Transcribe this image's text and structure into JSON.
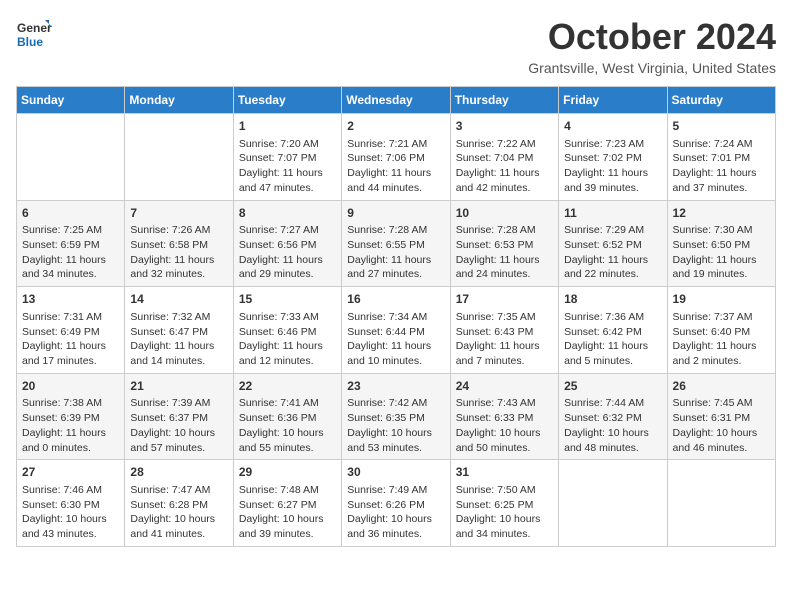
{
  "header": {
    "logo_line1": "General",
    "logo_line2": "Blue",
    "month": "October 2024",
    "location": "Grantsville, West Virginia, United States"
  },
  "days_of_week": [
    "Sunday",
    "Monday",
    "Tuesday",
    "Wednesday",
    "Thursday",
    "Friday",
    "Saturday"
  ],
  "weeks": [
    [
      {
        "day": "",
        "info": ""
      },
      {
        "day": "",
        "info": ""
      },
      {
        "day": "1",
        "info": "Sunrise: 7:20 AM\nSunset: 7:07 PM\nDaylight: 11 hours and 47 minutes."
      },
      {
        "day": "2",
        "info": "Sunrise: 7:21 AM\nSunset: 7:06 PM\nDaylight: 11 hours and 44 minutes."
      },
      {
        "day": "3",
        "info": "Sunrise: 7:22 AM\nSunset: 7:04 PM\nDaylight: 11 hours and 42 minutes."
      },
      {
        "day": "4",
        "info": "Sunrise: 7:23 AM\nSunset: 7:02 PM\nDaylight: 11 hours and 39 minutes."
      },
      {
        "day": "5",
        "info": "Sunrise: 7:24 AM\nSunset: 7:01 PM\nDaylight: 11 hours and 37 minutes."
      }
    ],
    [
      {
        "day": "6",
        "info": "Sunrise: 7:25 AM\nSunset: 6:59 PM\nDaylight: 11 hours and 34 minutes."
      },
      {
        "day": "7",
        "info": "Sunrise: 7:26 AM\nSunset: 6:58 PM\nDaylight: 11 hours and 32 minutes."
      },
      {
        "day": "8",
        "info": "Sunrise: 7:27 AM\nSunset: 6:56 PM\nDaylight: 11 hours and 29 minutes."
      },
      {
        "day": "9",
        "info": "Sunrise: 7:28 AM\nSunset: 6:55 PM\nDaylight: 11 hours and 27 minutes."
      },
      {
        "day": "10",
        "info": "Sunrise: 7:28 AM\nSunset: 6:53 PM\nDaylight: 11 hours and 24 minutes."
      },
      {
        "day": "11",
        "info": "Sunrise: 7:29 AM\nSunset: 6:52 PM\nDaylight: 11 hours and 22 minutes."
      },
      {
        "day": "12",
        "info": "Sunrise: 7:30 AM\nSunset: 6:50 PM\nDaylight: 11 hours and 19 minutes."
      }
    ],
    [
      {
        "day": "13",
        "info": "Sunrise: 7:31 AM\nSunset: 6:49 PM\nDaylight: 11 hours and 17 minutes."
      },
      {
        "day": "14",
        "info": "Sunrise: 7:32 AM\nSunset: 6:47 PM\nDaylight: 11 hours and 14 minutes."
      },
      {
        "day": "15",
        "info": "Sunrise: 7:33 AM\nSunset: 6:46 PM\nDaylight: 11 hours and 12 minutes."
      },
      {
        "day": "16",
        "info": "Sunrise: 7:34 AM\nSunset: 6:44 PM\nDaylight: 11 hours and 10 minutes."
      },
      {
        "day": "17",
        "info": "Sunrise: 7:35 AM\nSunset: 6:43 PM\nDaylight: 11 hours and 7 minutes."
      },
      {
        "day": "18",
        "info": "Sunrise: 7:36 AM\nSunset: 6:42 PM\nDaylight: 11 hours and 5 minutes."
      },
      {
        "day": "19",
        "info": "Sunrise: 7:37 AM\nSunset: 6:40 PM\nDaylight: 11 hours and 2 minutes."
      }
    ],
    [
      {
        "day": "20",
        "info": "Sunrise: 7:38 AM\nSunset: 6:39 PM\nDaylight: 11 hours and 0 minutes."
      },
      {
        "day": "21",
        "info": "Sunrise: 7:39 AM\nSunset: 6:37 PM\nDaylight: 10 hours and 57 minutes."
      },
      {
        "day": "22",
        "info": "Sunrise: 7:41 AM\nSunset: 6:36 PM\nDaylight: 10 hours and 55 minutes."
      },
      {
        "day": "23",
        "info": "Sunrise: 7:42 AM\nSunset: 6:35 PM\nDaylight: 10 hours and 53 minutes."
      },
      {
        "day": "24",
        "info": "Sunrise: 7:43 AM\nSunset: 6:33 PM\nDaylight: 10 hours and 50 minutes."
      },
      {
        "day": "25",
        "info": "Sunrise: 7:44 AM\nSunset: 6:32 PM\nDaylight: 10 hours and 48 minutes."
      },
      {
        "day": "26",
        "info": "Sunrise: 7:45 AM\nSunset: 6:31 PM\nDaylight: 10 hours and 46 minutes."
      }
    ],
    [
      {
        "day": "27",
        "info": "Sunrise: 7:46 AM\nSunset: 6:30 PM\nDaylight: 10 hours and 43 minutes."
      },
      {
        "day": "28",
        "info": "Sunrise: 7:47 AM\nSunset: 6:28 PM\nDaylight: 10 hours and 41 minutes."
      },
      {
        "day": "29",
        "info": "Sunrise: 7:48 AM\nSunset: 6:27 PM\nDaylight: 10 hours and 39 minutes."
      },
      {
        "day": "30",
        "info": "Sunrise: 7:49 AM\nSunset: 6:26 PM\nDaylight: 10 hours and 36 minutes."
      },
      {
        "day": "31",
        "info": "Sunrise: 7:50 AM\nSunset: 6:25 PM\nDaylight: 10 hours and 34 minutes."
      },
      {
        "day": "",
        "info": ""
      },
      {
        "day": "",
        "info": ""
      }
    ]
  ]
}
